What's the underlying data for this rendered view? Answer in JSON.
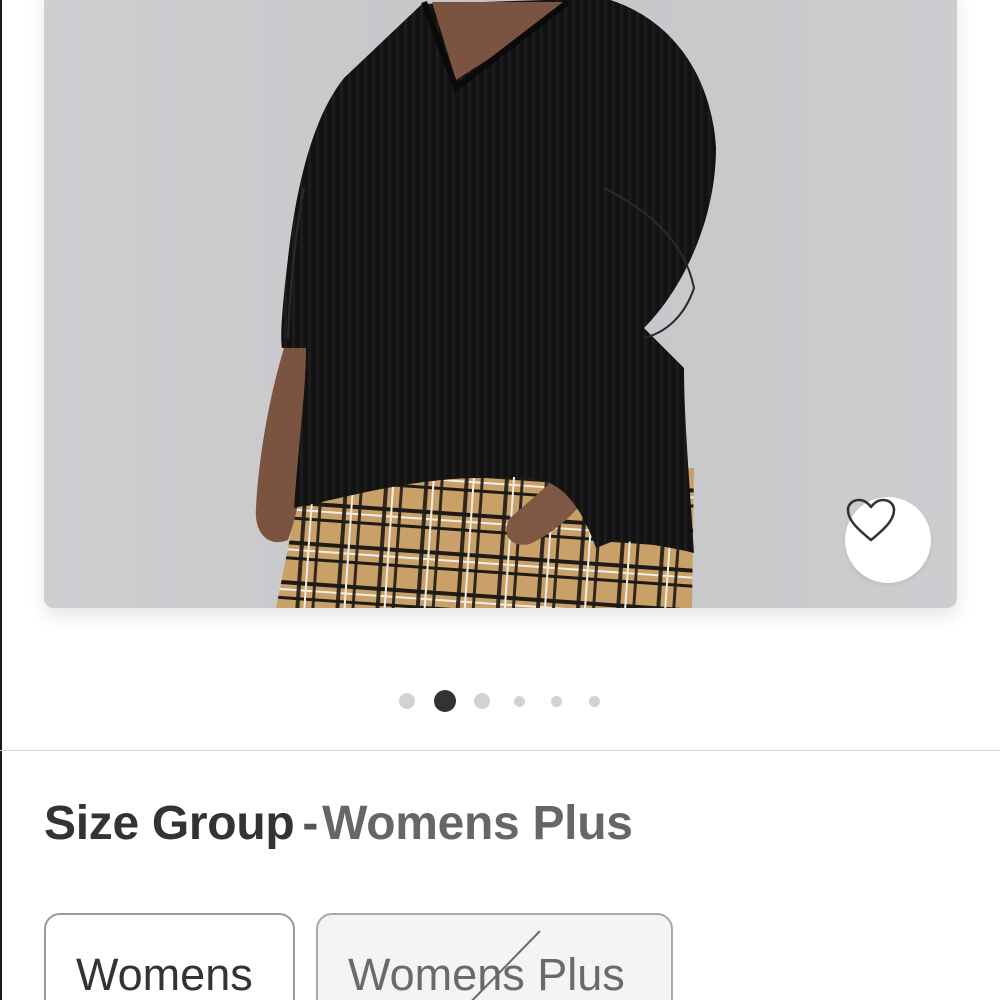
{
  "product_image": {
    "alt": "",
    "favorite": {
      "icon": "heart-outline-icon",
      "state": "not-favorited"
    }
  },
  "carousel": {
    "total_images": 6,
    "active_index": 1
  },
  "size_group": {
    "label": "Size Group",
    "separator": "-",
    "selected_value": "Womens Plus",
    "options": [
      {
        "label": "Womens",
        "available": true
      },
      {
        "label": "Womens Plus",
        "available": false
      }
    ]
  },
  "colors": {
    "heading_text": "#333333",
    "active_dot": "#333333",
    "inactive_dot": "#d2d2d2",
    "image_background": "#c9c9cc"
  }
}
